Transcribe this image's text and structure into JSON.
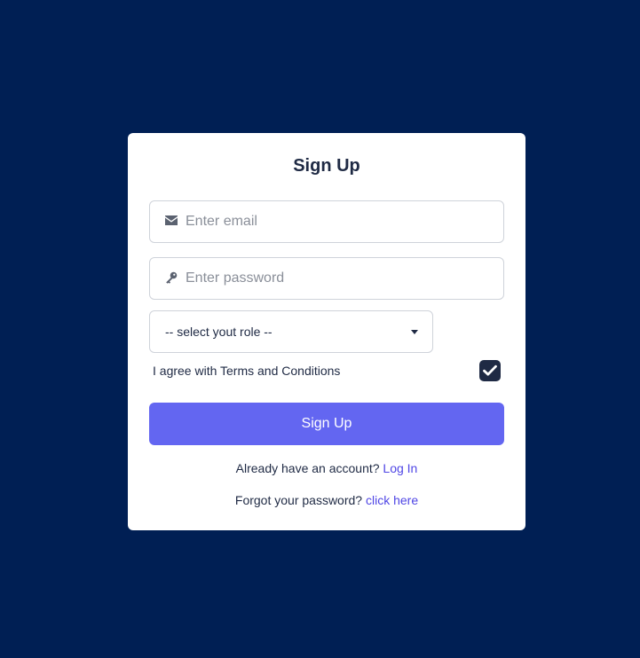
{
  "form": {
    "title": "Sign Up",
    "email": {
      "placeholder": "Enter email",
      "icon": "envelope-icon"
    },
    "password": {
      "placeholder": "Enter password",
      "icon": "key-icon"
    },
    "role": {
      "selected": "-- select yout role --"
    },
    "terms": {
      "label": "I agree with Terms and Conditions",
      "checked": true
    },
    "submit_label": "Sign Up",
    "login_prompt": "Already have an account?",
    "login_link": "Log In",
    "forgot_prompt": "Forgot your password?",
    "forgot_link": "click here"
  },
  "colors": {
    "background": "#001f54",
    "card": "#ffffff",
    "primary": "#6366f1",
    "link": "#4f46e5",
    "text": "#1f2a44"
  }
}
